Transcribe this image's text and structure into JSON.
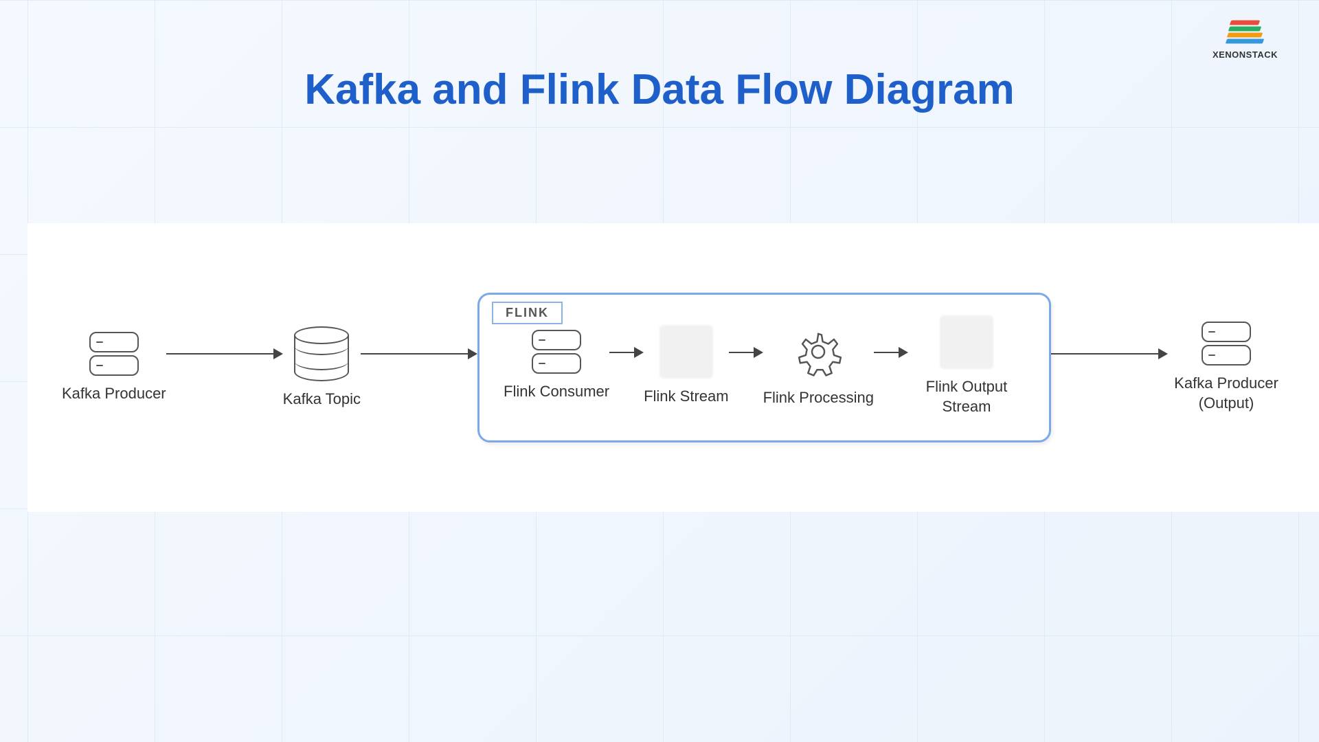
{
  "title": "Kafka and Flink Data Flow Diagram",
  "brand": "XENONSTACK",
  "flink_group_label": "FLINK",
  "nodes": {
    "kafka_producer": "Kafka Producer",
    "kafka_topic": "Kafka Topic",
    "flink_consumer": "Flink Consumer",
    "flink_stream": "Flink Stream",
    "flink_processing": "Flink Processing",
    "flink_output_stream": "Flink Output Stream",
    "kafka_producer_output": "Kafka Producer (Output)"
  },
  "flow_edges": [
    [
      "kafka_producer",
      "kafka_topic"
    ],
    [
      "kafka_topic",
      "flink_consumer"
    ],
    [
      "flink_consumer",
      "flink_stream"
    ],
    [
      "flink_stream",
      "flink_processing"
    ],
    [
      "flink_processing",
      "flink_output_stream"
    ],
    [
      "flink_output_stream",
      "kafka_producer_output"
    ]
  ]
}
